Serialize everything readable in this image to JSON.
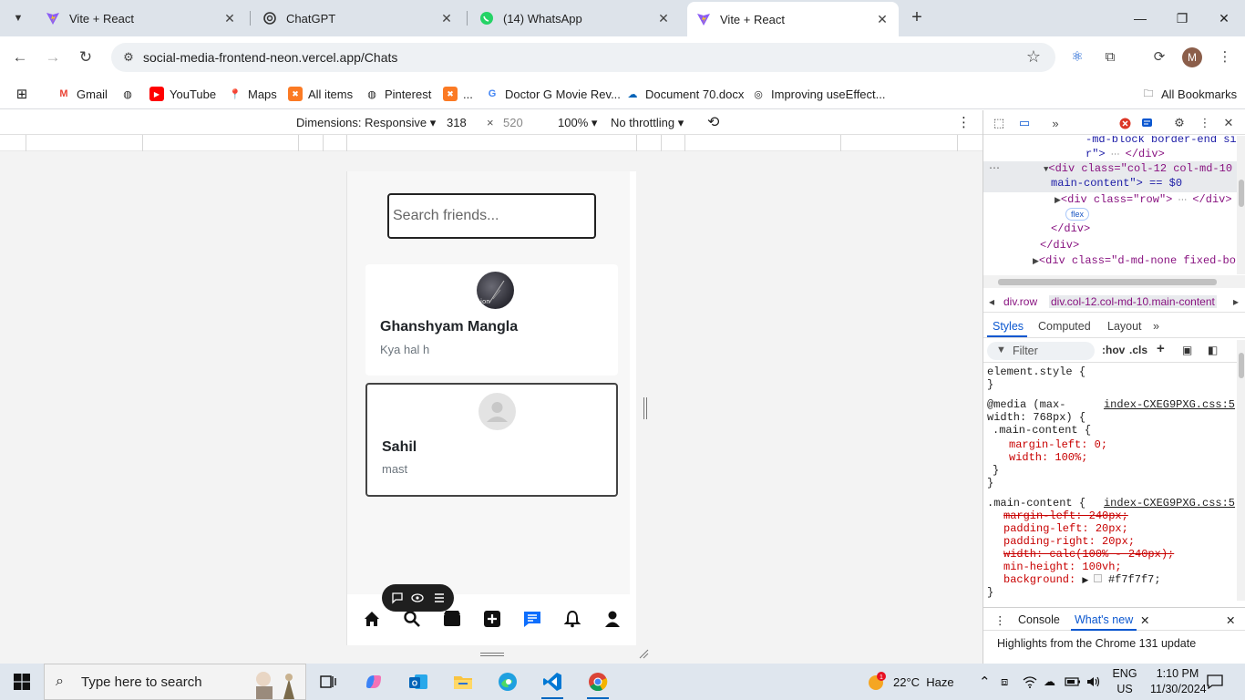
{
  "browser": {
    "tabs": [
      {
        "title": "Vite + React",
        "favicon": "vite-icon",
        "active": false
      },
      {
        "title": "ChatGPT",
        "favicon": "chatgpt-icon",
        "active": false
      },
      {
        "title": "(14) WhatsApp",
        "favicon": "whatsapp-icon",
        "active": false
      },
      {
        "title": "Vite + React",
        "favicon": "vite-icon",
        "active": true
      }
    ],
    "url": "social-media-frontend-neon.vercel.app/Chats",
    "profile_initial": "M"
  },
  "bookmarks": {
    "items": [
      {
        "label": "Gmail",
        "icon": "gmail-icon"
      },
      {
        "label": "",
        "icon": "globe-icon"
      },
      {
        "label": "YouTube",
        "icon": "youtube-icon"
      },
      {
        "label": "Maps",
        "icon": "maps-icon"
      },
      {
        "label": "All items",
        "icon": "xampp-icon"
      },
      {
        "label": "Pinterest",
        "icon": "globe-icon"
      },
      {
        "label": "...",
        "icon": "xampp-icon"
      },
      {
        "label": "Doctor G Movie Rev...",
        "icon": "google-icon"
      },
      {
        "label": "Document 70.docx",
        "icon": "onedrive-icon"
      },
      {
        "label": "Improving useEffect...",
        "icon": "chatgpt-icon"
      }
    ],
    "all_bookmarks": "All Bookmarks"
  },
  "device_toolbar": {
    "dimensions_label": "Dimensions: Responsive",
    "width": "318",
    "height": "520",
    "times": "×",
    "zoom": "100%",
    "throttling": "No throttling"
  },
  "app": {
    "search_placeholder": "Search friends...",
    "friends": [
      {
        "name": "Ghanshyam Mangla",
        "last_message": "Kya hal h",
        "avatar_text": "ion"
      },
      {
        "name": "Sahil",
        "last_message": "mast"
      }
    ],
    "nav": [
      "home-icon",
      "search-icon",
      "reels-icon",
      "add-post-icon",
      "chat-icon",
      "notification-bell-icon",
      "profile-icon"
    ],
    "nav_active": "chat-icon"
  },
  "devtools": {
    "dom_lines": [
      {
        "text": "-md-block border-end sideba"
      },
      {
        "text": "r\">"
      },
      {
        "text": "<div class=\"col-12 col-md-10"
      },
      {
        "text": "main-content\"> == $0"
      },
      {
        "text": "<div class=\"row\">"
      },
      {
        "text": "flex"
      },
      {
        "text": "</div>"
      },
      {
        "text": "</div>"
      },
      {
        "text": "<div class=\"d-md-none fixed-bot"
      }
    ],
    "breadcrumbs": [
      "div.row",
      "div.col-12.col-md-10.main-content"
    ],
    "subtabs": [
      "Styles",
      "Computed",
      "Layout"
    ],
    "filter_placeholder": "Filter",
    "hov": ":hov",
    "cls": ".cls",
    "rules": {
      "element_style": "element.style {",
      "close": "}",
      "media_1": "@media (max-",
      "media_2": "width: 768px) {",
      "source": "index-CXEG9PXG.css:5",
      "selector": ".main-content {",
      "margin_left_0": "margin-left: 0;",
      "width_100": "width: 100%;",
      "margin_left_240": "margin-left: 240px;",
      "padding_left": "padding-left: 20px;",
      "padding_right": "padding-right: 20px;",
      "width_calc": "width: calc(100% - 240px);",
      "min_height": "min-height: 100vh;",
      "background": "background: ",
      "background_value": "#f7f7f7;"
    },
    "drawer_tabs": [
      "Console",
      "What's new"
    ],
    "drawer_message": "Highlights from the Chrome 131 update"
  },
  "taskbar": {
    "search_placeholder": "Type here to search",
    "weather_temp": "22°C",
    "weather_desc": "Haze",
    "language_1": "ENG",
    "language_2": "US",
    "time": "1:10 PM",
    "date": "11/30/2024",
    "notification_count": "1"
  },
  "colors": {
    "accent_blue": "#0b57d0",
    "chat_active": "#0d6efd",
    "app_background": "#f7f7f7"
  }
}
